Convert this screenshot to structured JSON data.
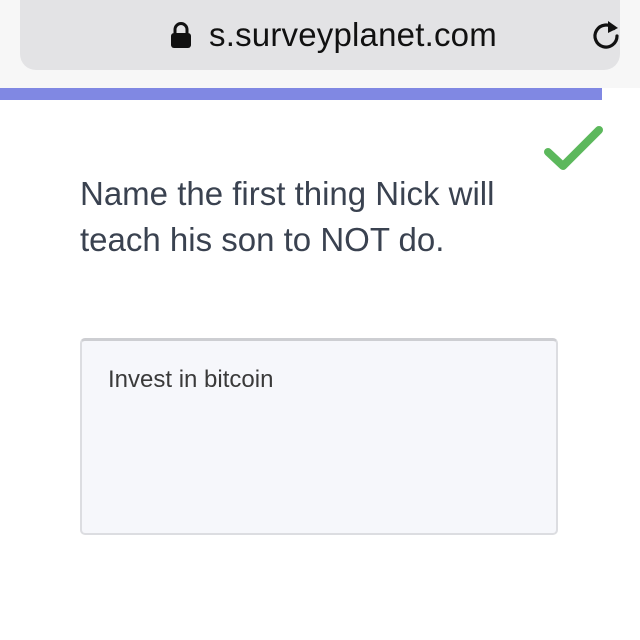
{
  "browser": {
    "url": "s.surveyplanet.com",
    "lock_icon": "lock-icon",
    "reload_icon": "reload-icon"
  },
  "progress": {
    "fraction": 0.94,
    "color": "#8088e3"
  },
  "survey": {
    "question": "Name the first thing Nick will teach his son to NOT do.",
    "answer": "Invest in bitcoin",
    "status_icon": "checkmark-icon",
    "status_color": "#5cb85c"
  }
}
